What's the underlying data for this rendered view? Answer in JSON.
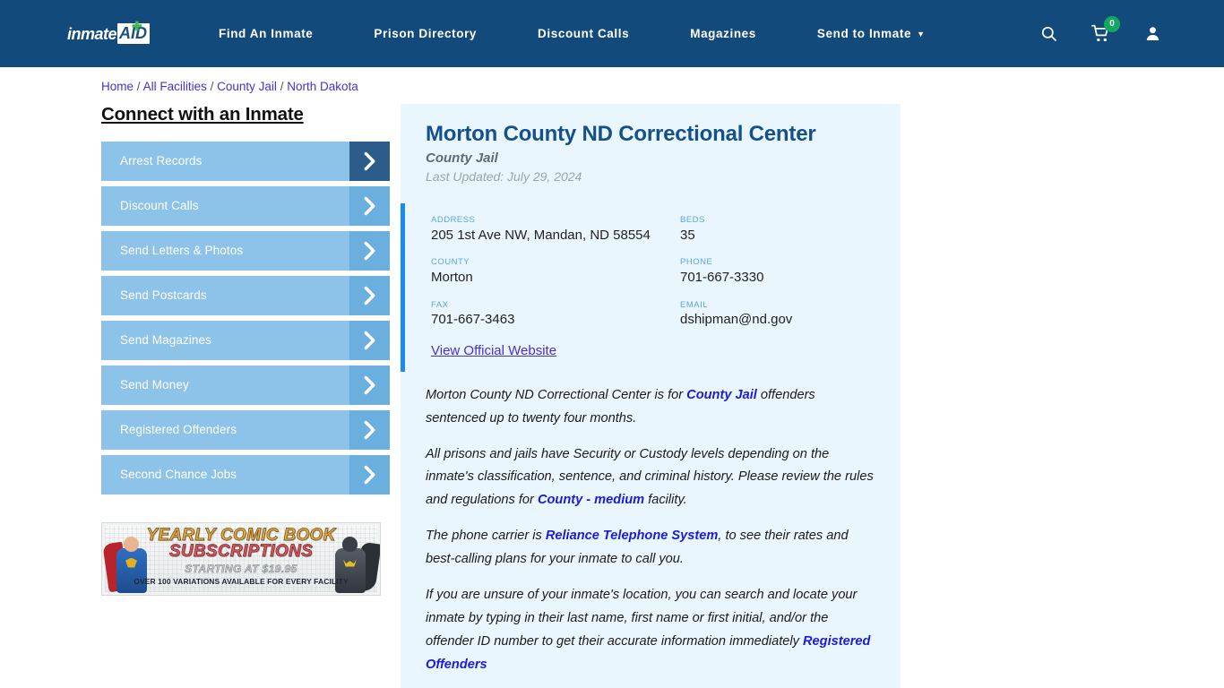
{
  "header": {
    "logo_text": "inmate",
    "logo_badge": "AID",
    "logo_plus": "✚",
    "nav": [
      {
        "label": "Find An Inmate"
      },
      {
        "label": "Prison Directory"
      },
      {
        "label": "Discount Calls"
      },
      {
        "label": "Magazines"
      },
      {
        "label": "Send to Inmate",
        "caret": "▼"
      }
    ],
    "icons": {
      "search": "search-icon",
      "cart": "cart-icon",
      "cart_count": "0",
      "account": "user-icon"
    },
    "colors": {
      "bar": "#134a7c",
      "badge": "#13a75f"
    }
  },
  "breadcrumb": {
    "items": [
      "Home",
      "All Facilities",
      "County Jail",
      "North Dakota"
    ],
    "separator": "/"
  },
  "sidebar": {
    "title": "Connect with an Inmate",
    "arrow_glyph": "›",
    "items": [
      {
        "label": "Arrest Records",
        "active": true
      },
      {
        "label": "Discount Calls",
        "active": false
      },
      {
        "label": "Send Letters & Photos",
        "active": false
      },
      {
        "label": "Send Postcards",
        "active": false
      },
      {
        "label": "Send Magazines",
        "active": false
      },
      {
        "label": "Send Money",
        "active": false
      },
      {
        "label": "Registered Offenders",
        "active": false
      },
      {
        "label": "Second Chance Jobs",
        "active": false
      }
    ]
  },
  "ad": {
    "line1": "YEARLY COMIC BOOK",
    "line2": "SUBSCRIPTIONS",
    "line3": "STARTING AT $19.95",
    "line4": "OVER 100 VARIATIONS AVAILABLE FOR EVERY FACILITY"
  },
  "facility": {
    "name": "Morton County ND Correctional Center",
    "type": "County Jail",
    "last_updated": "Last Updated: July 29, 2024",
    "fields": [
      {
        "label": "ADDRESS",
        "value": "205 1st Ave NW, Mandan, ND 58554"
      },
      {
        "label": "BEDS",
        "value": "35"
      },
      {
        "label": "COUNTY",
        "value": "Morton"
      },
      {
        "label": "PHONE",
        "value": "701-667-3330"
      },
      {
        "label": "FAX",
        "value": "701-667-3463"
      },
      {
        "label": "EMAIL",
        "value": "dshipman@nd.gov"
      }
    ],
    "official_website_label": "View Official Website"
  },
  "description": {
    "p1_a": "Morton County ND Correctional Center is for ",
    "p1_link": "County Jail",
    "p1_b": " offenders sentenced up to twenty four months.",
    "p2_a": "All prisons and jails have Security or Custody levels depending on the inmate's classification, sentence, and criminal history. Please review the rules and regulations for ",
    "p2_link": "County - medium",
    "p2_b": " facility.",
    "p3_a": "The phone carrier is ",
    "p3_link": "Reliance Telephone System",
    "p3_b": ", to see their rates and best-calling plans for your inmate to call you.",
    "p4_a": "If you are unsure of your inmate's location, you can search and locate your inmate by typing in their last name, first name or first initial, and/or the offender ID number to get their accurate information immediately ",
    "p4_link": "Registered Offenders"
  }
}
